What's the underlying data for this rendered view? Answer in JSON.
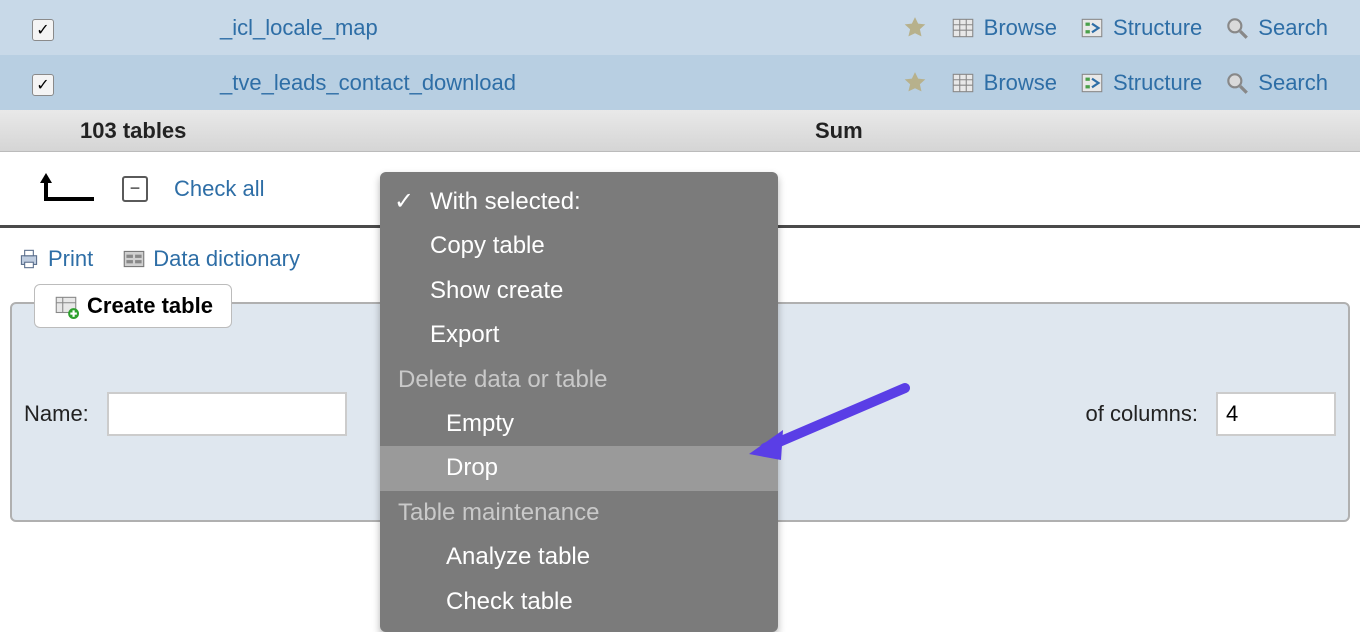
{
  "rows": [
    {
      "name": "_icl_locale_map"
    },
    {
      "name": "_tve_leads_contact_download"
    }
  ],
  "actions": {
    "browse": "Browse",
    "structure": "Structure",
    "search": "Search"
  },
  "summary": {
    "countLabel": "103 tables",
    "sumLabel": "Sum"
  },
  "toolbar": {
    "checkAll": "Check all",
    "print": "Print",
    "dataDict": "Data dictionary"
  },
  "create": {
    "button": "Create table",
    "nameLabel": "Name:",
    "colsLabel": "of columns:",
    "colsValue": "4"
  },
  "dropdown": {
    "withSelected": "With selected:",
    "copy": "Copy table",
    "showCreate": "Show create",
    "export": "Export",
    "groupDelete": "Delete data or table",
    "empty": "Empty",
    "drop": "Drop",
    "groupMaint": "Table maintenance",
    "analyze": "Analyze table",
    "check": "Check table"
  }
}
